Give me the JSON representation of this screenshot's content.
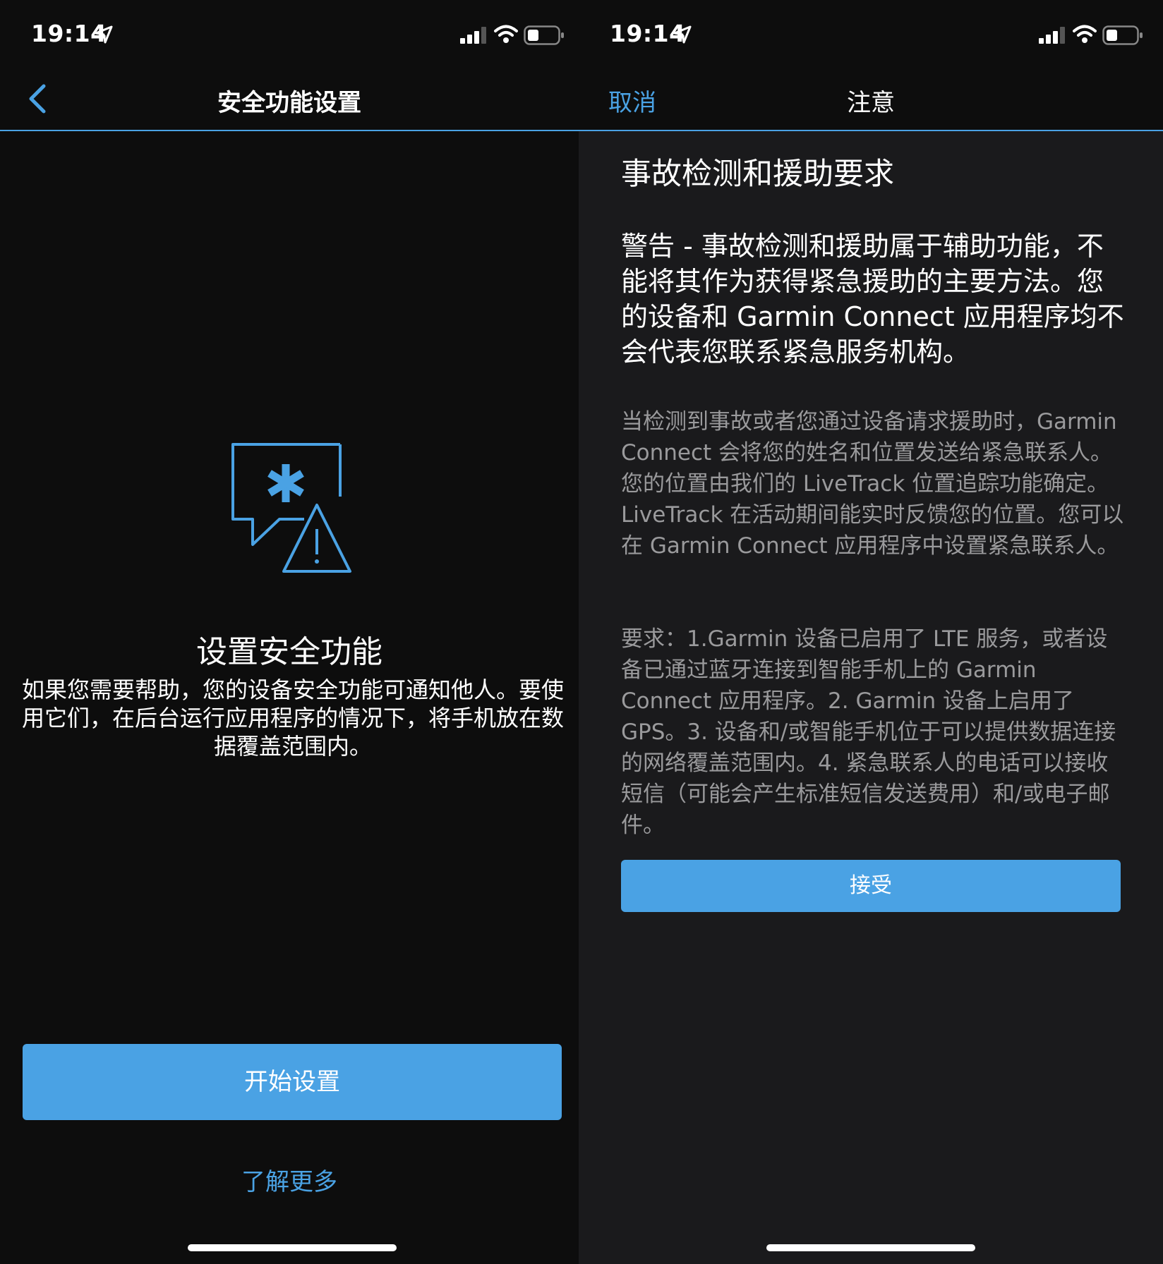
{
  "left": {
    "status": {
      "time": "19:14"
    },
    "nav": {
      "title": "安全功能设置"
    },
    "heading": "设置安全功能",
    "description": "如果您需要帮助，您的设备安全功能可通知他人。要使用它们，在后台运行应用程序的情况下，将手机放在数据覆盖范围内。",
    "start_button": "开始设置",
    "learn_more": "了解更多"
  },
  "right": {
    "status": {
      "time": "19:14"
    },
    "nav": {
      "cancel": "取消",
      "title": "注意"
    },
    "title": "事故检测和援助要求",
    "warning": "警告 - 事故检测和援助属于辅助功能，不能将其作为获得紧急援助的主要方法。您的设备和 Garmin Connect 应用程序均不会代表您联系紧急服务机构。",
    "info": "当检测到事故或者您通过设备请求援助时，Garmin Connect 会将您的姓名和位置发送给紧急联系人。您的位置由我们的 LiveTrack 位置追踪功能确定。LiveTrack 在活动期间能实时反馈您的位置。您可以在 Garmin Connect 应用程序中设置紧急联系人。",
    "requirements": "要求：1.Garmin 设备已启用了 LTE 服务，或者设备已通过蓝牙连接到智能手机上的 Garmin Connect 应用程序。2. Garmin 设备上启用了 GPS。3. 设备和/或智能手机位于可以提供数据连接的网络覆盖范围内。4. 紧急联系人的电话可以接收短信（可能会产生标准短信发送费用）和/或电子邮件。",
    "accept_button": "接受"
  },
  "colors": {
    "accent": "#4aa2e4",
    "background_left": "#0d0d0d",
    "background_right": "#1a1a1c",
    "secondary_text": "#9a9a9c"
  },
  "icons": [
    "location-arrow-icon",
    "signal-icon",
    "wifi-icon",
    "battery-icon",
    "back-chevron-icon",
    "safety-alert-icon"
  ]
}
